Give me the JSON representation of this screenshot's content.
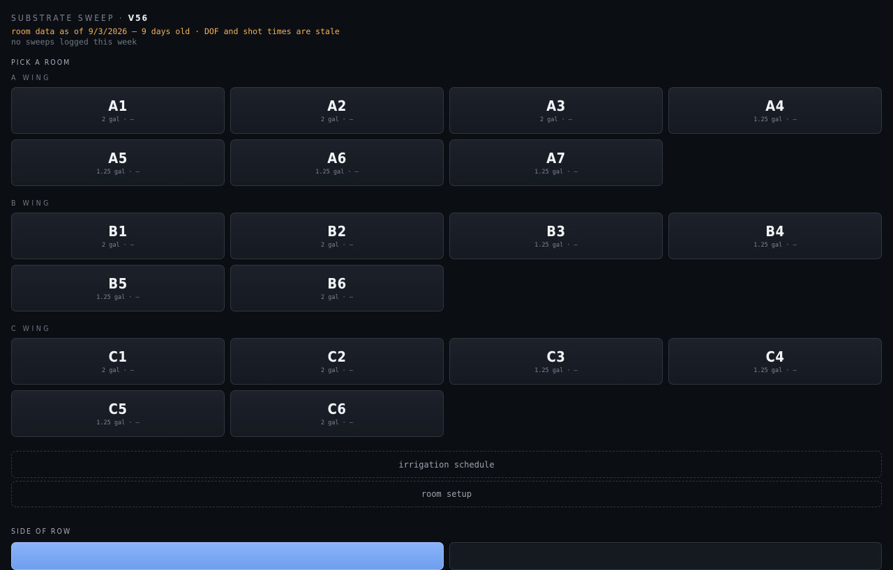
{
  "header": {
    "app_name": "SUBSTRATE SWEEP ·",
    "version": "V56",
    "stale_warning": "room data as of 9/3/2026 — 9 days old · DOF and shot times are stale",
    "sweep_note": "no sweeps logged this week"
  },
  "pick_room_label": "PICK A ROOM",
  "wings": [
    {
      "label": "A WING",
      "rooms": [
        {
          "name": "A1",
          "meta": "2 gal · —"
        },
        {
          "name": "A2",
          "meta": "2 gal · —"
        },
        {
          "name": "A3",
          "meta": "2 gal · —"
        },
        {
          "name": "A4",
          "meta": "1.25 gal · —"
        },
        {
          "name": "A5",
          "meta": "1.25 gal · —"
        },
        {
          "name": "A6",
          "meta": "1.25 gal · —"
        },
        {
          "name": "A7",
          "meta": "1.25 gal · —"
        }
      ]
    },
    {
      "label": "B WING",
      "rooms": [
        {
          "name": "B1",
          "meta": "2 gal · —"
        },
        {
          "name": "B2",
          "meta": "2 gal · —"
        },
        {
          "name": "B3",
          "meta": "1.25 gal · —"
        },
        {
          "name": "B4",
          "meta": "1.25 gal · —"
        },
        {
          "name": "B5",
          "meta": "1.25 gal · —"
        },
        {
          "name": "B6",
          "meta": "2 gal · —"
        }
      ]
    },
    {
      "label": "C WING",
      "rooms": [
        {
          "name": "C1",
          "meta": "2 gal · —"
        },
        {
          "name": "C2",
          "meta": "2 gal · —"
        },
        {
          "name": "C3",
          "meta": "1.25 gal · —"
        },
        {
          "name": "C4",
          "meta": "1.25 gal · —"
        },
        {
          "name": "C5",
          "meta": "1.25 gal · —"
        },
        {
          "name": "C6",
          "meta": "2 gal · —"
        }
      ]
    }
  ],
  "actions": {
    "irrigation_schedule": "irrigation schedule",
    "room_setup": "room setup"
  },
  "side_of_row_label": "SIDE OF ROW",
  "colors": {
    "background": "#0b0e12",
    "warning": "#f0b35a",
    "selected_side": "#8ab4f8"
  }
}
